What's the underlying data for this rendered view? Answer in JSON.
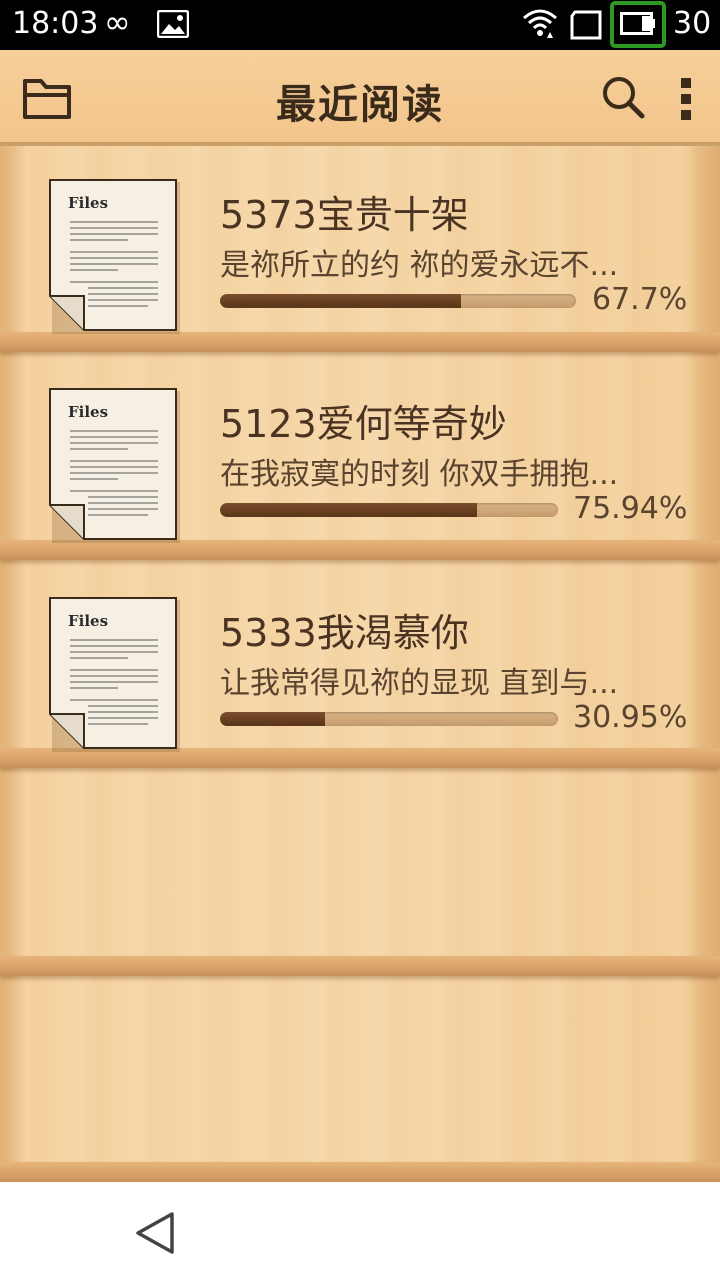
{
  "status_bar": {
    "time": "18:03",
    "battery_level": "30",
    "icons": [
      "infinity-icon",
      "image-icon",
      "wifi-icon",
      "tablet-icon",
      "battery-icon"
    ]
  },
  "header": {
    "title": "最近阅读",
    "icons": [
      "folder-icon",
      "search-icon",
      "more-vert-icon"
    ]
  },
  "books": [
    {
      "cover_label": "Files",
      "title": "5373宝贵十架",
      "excerpt": "是祢所立的约 祢的爱永远不...",
      "progress": 0.677,
      "progress_text": "67.7%"
    },
    {
      "cover_label": "Files",
      "title": "5123爱何等奇妙",
      "excerpt": "在我寂寞的时刻 你双手拥抱...",
      "progress": 0.7594,
      "progress_text": "75.94%"
    },
    {
      "cover_label": "Files",
      "title": "5333我渴慕你",
      "excerpt": "让我常得见祢的显现 直到与...",
      "progress": 0.3095,
      "progress_text": "30.95%"
    }
  ],
  "colors": {
    "header_bg": "#f3c98f",
    "shelf_wood": "#f6d4a2",
    "progress_fill": "#6b4222",
    "progress_track": "#d1a876",
    "battery_highlight": "#2d9a22"
  }
}
